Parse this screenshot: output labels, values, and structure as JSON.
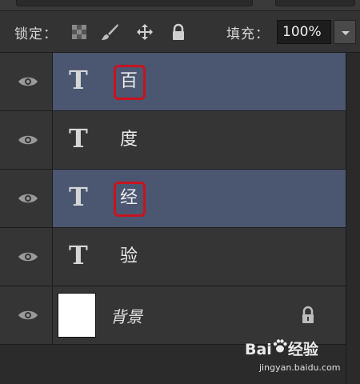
{
  "lock_bar": {
    "lock_label": "锁定：",
    "lock_icons": [
      "lock-transparent-pixels-icon",
      "lock-image-pixels-icon",
      "lock-position-icon",
      "lock-all-icon"
    ],
    "fill_label": "填充：",
    "fill_value": "100%"
  },
  "layers": [
    {
      "type": "text",
      "name": "百",
      "selected": true,
      "highlighted": true
    },
    {
      "type": "text",
      "name": "度",
      "selected": false,
      "highlighted": false
    },
    {
      "type": "text",
      "name": "经",
      "selected": true,
      "highlighted": true
    },
    {
      "type": "text",
      "name": "验",
      "selected": false,
      "highlighted": false
    },
    {
      "type": "image",
      "name": "背景",
      "locked": true
    }
  ],
  "text_layer_icon": "T",
  "colors": {
    "selected": "#4b5670",
    "highlight": "#c8141f",
    "panel": "#353535"
  },
  "watermark": {
    "brand": "Bai",
    "brand2": "经验",
    "url": "jingyan.baidu.com"
  }
}
